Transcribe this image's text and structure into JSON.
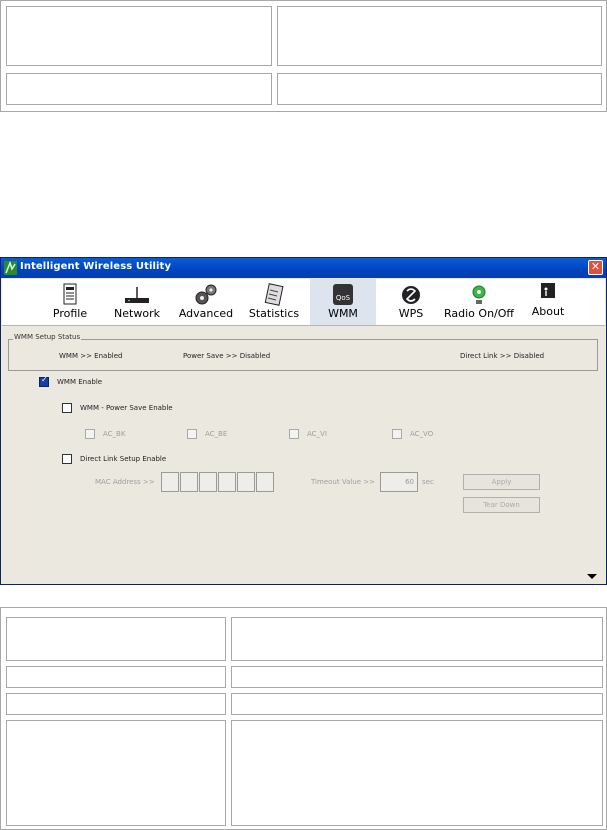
{
  "window": {
    "title": "Intelligent Wireless Utility",
    "close_label": "✕"
  },
  "toolbar": {
    "items": [
      {
        "label": "Profile"
      },
      {
        "label": "Network"
      },
      {
        "label": "Advanced"
      },
      {
        "label": "Statistics"
      },
      {
        "label": "WMM"
      },
      {
        "label": "WPS"
      },
      {
        "label": "Radio On/Off"
      },
      {
        "label": "About"
      }
    ],
    "active": "WMM",
    "qos_icon_text": "QoS"
  },
  "status": {
    "group_title": "WMM Setup Status",
    "wmm": "WMM >> Enabled",
    "power_save": "Power Save >> Disabled",
    "direct_link": "Direct Link >> Disabled"
  },
  "wmm_enable": {
    "label": "WMM Enable",
    "checked": true
  },
  "power_save": {
    "label": "WMM - Power Save Enable",
    "checked": false
  },
  "ac": [
    "AC_BK",
    "AC_BE",
    "AC_VI",
    "AC_VO"
  ],
  "direct_link": {
    "label": "Direct Link Setup Enable",
    "checked": false
  },
  "mac_label": "MAC Address >>",
  "timeout_label": "Timeout Value >>",
  "timeout_value": "60",
  "timeout_unit": "sec",
  "buttons": {
    "apply": "Apply",
    "tear_down": "Tear Down"
  }
}
